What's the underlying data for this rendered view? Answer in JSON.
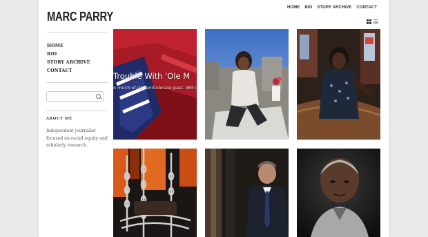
{
  "site": {
    "title": "MARC PARRY"
  },
  "topnav": [
    {
      "label": "HOME"
    },
    {
      "label": "BIO"
    },
    {
      "label": "STORY ARCHIVE"
    },
    {
      "label": "CONTACT"
    }
  ],
  "view_toggle": {
    "grid_icon": "grid-view-icon",
    "list_icon": "list-view-icon"
  },
  "sidebar": {
    "nav": [
      {
        "label": "HOME"
      },
      {
        "label": "BIO"
      },
      {
        "label": "STORY ARCHIVE"
      },
      {
        "label": "CONTACT"
      }
    ],
    "search": {
      "placeholder": "",
      "icon": "search-icon"
    },
    "about_title": "ABOUT ME",
    "about_lines": [
      "Independent journalist",
      "focused on racial equity and",
      "scholarly research."
    ]
  },
  "tiles": [
    {
      "title": "Trouble With 'Ole M",
      "dek": "n much of its Confederate past. Will it",
      "accent": "#b01d28"
    },
    {
      "title": "",
      "dek": "",
      "accent": "#7a6a5e"
    },
    {
      "title": "",
      "dek": "",
      "accent": "#3a2a22"
    },
    {
      "title": "",
      "dek": "",
      "accent": "#d35a18"
    },
    {
      "title": "",
      "dek": "",
      "accent": "#5a4a3c"
    },
    {
      "title": "",
      "dek": "",
      "accent": "#404040"
    }
  ]
}
